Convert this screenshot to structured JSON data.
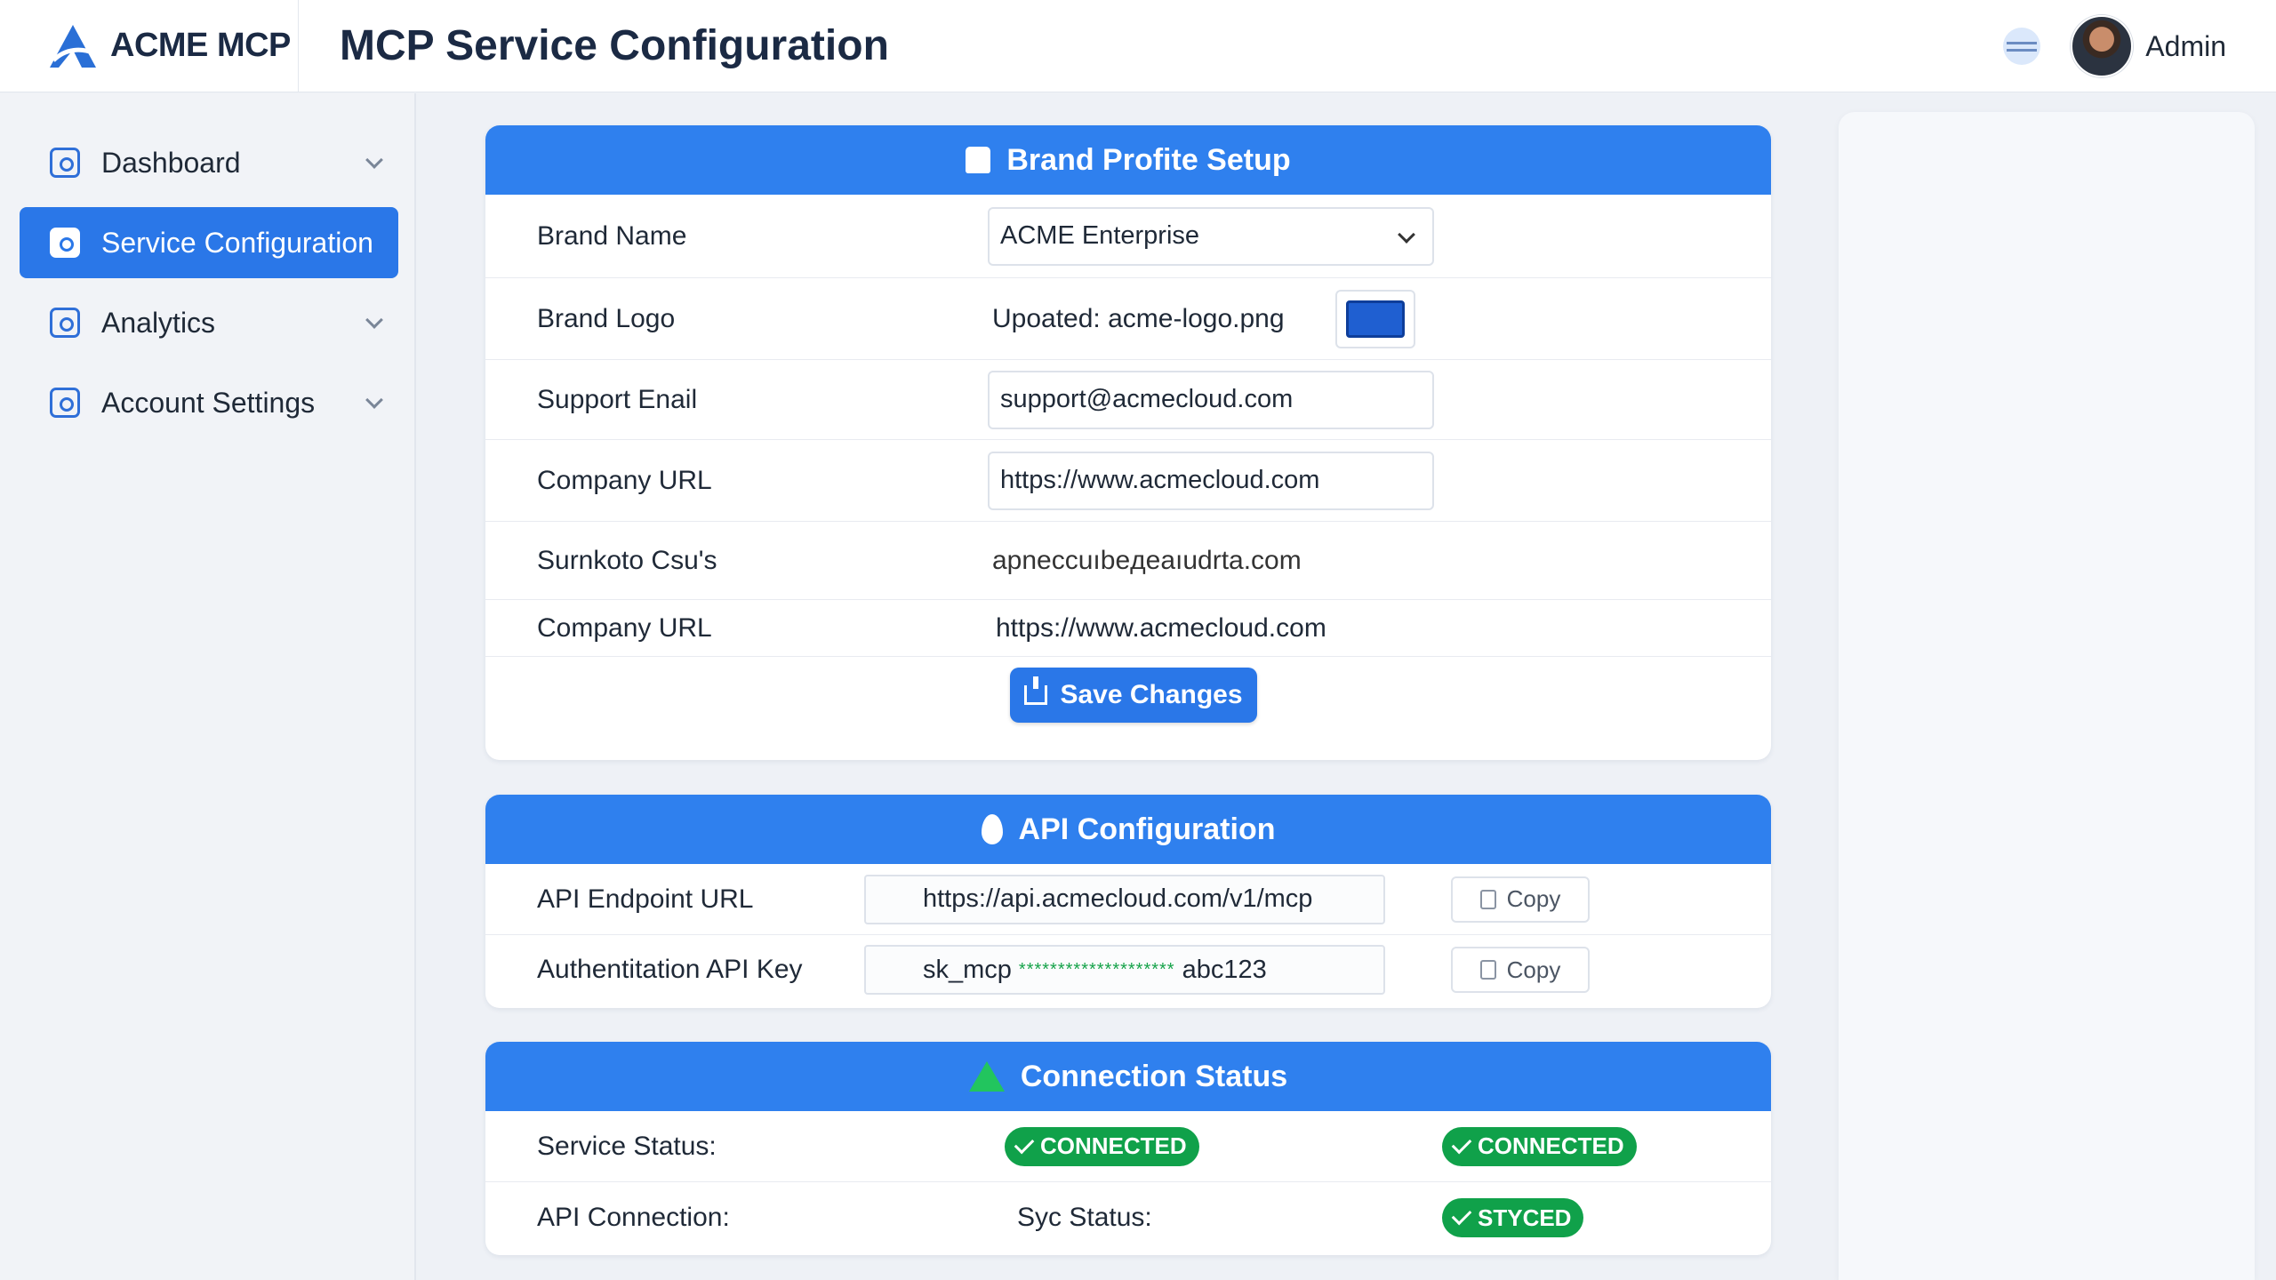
{
  "app": {
    "brand_name": "ACME MCP",
    "page_title": "MCP Service Configuration",
    "user_name": "Admin"
  },
  "sidebar": {
    "items": [
      {
        "label": "Dashboard",
        "icon": "dashboard-icon",
        "active": false,
        "expandable": true
      },
      {
        "label": "Service Configuration",
        "icon": "service-config-icon",
        "active": true,
        "expandable": false
      },
      {
        "label": "Analytics",
        "icon": "analytics-icon",
        "active": false,
        "expandable": true
      },
      {
        "label": "Account Settings",
        "icon": "account-settings-icon",
        "active": false,
        "expandable": true
      }
    ]
  },
  "brand_profile": {
    "title": "Brand Profite Setup",
    "rows": {
      "brand_name_label": "Brand Name",
      "brand_name_value": "ACME Enterprise",
      "brand_logo_label": "Brand Logo",
      "brand_logo_value": "Upoated: acme-logo.png",
      "support_email_label": "Support Enail",
      "support_email_value": "support@acmecloud.com",
      "company_url_label": "Company URL",
      "company_url_value": "https://www.acmecloud.com",
      "garbled_label": "Surnkoto Csu's",
      "garbled_value": "apneccuıbeдeaıudrta.com",
      "company_url2_label": "Company URL",
      "company_url2_value": "https://www.acmecloud.com"
    },
    "save_label": "Save Changes"
  },
  "api_config": {
    "title": "API Configuration",
    "endpoint_label": "API Endpoint URL",
    "endpoint_value": "https://api.acmecloud.com/v1/mcp",
    "key_label": "Authentitation API Key",
    "key_prefix": "sk_mcp",
    "key_mask": "********************",
    "key_suffix": "abc123",
    "copy_label": "Copy"
  },
  "connection": {
    "title": "Connection Status",
    "service_status_label": "Service Status:",
    "service_badge_1": "CONNECTED",
    "service_badge_2": "CONNECTED",
    "api_connection_label": "API Connection:",
    "sync_status_label": "Syc Status:",
    "sync_badge": "STYCED"
  },
  "colors": {
    "accent": "#2f80ee",
    "success": "#10a14a",
    "sidebar_active": "#2a77e8"
  }
}
